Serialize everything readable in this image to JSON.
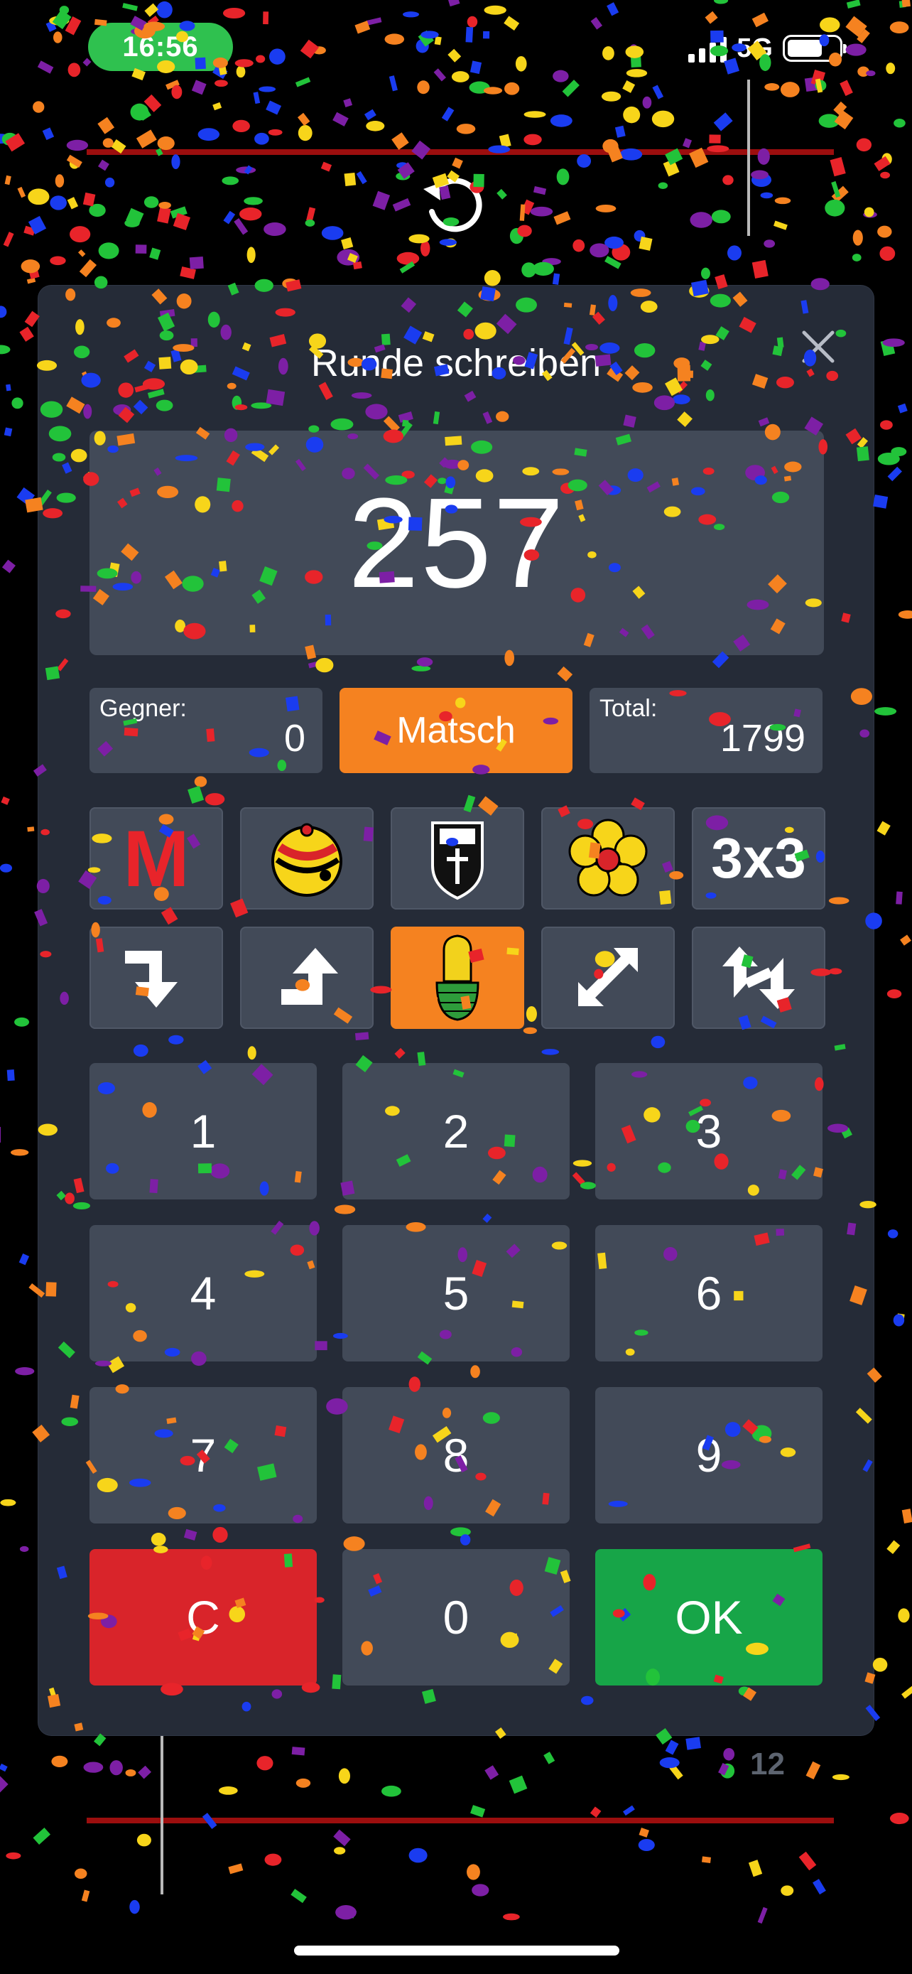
{
  "status_bar": {
    "time": "16:56",
    "network": "5G"
  },
  "background": {
    "score_number": "12"
  },
  "modal": {
    "title": "Runde schreiben",
    "display_value": "257",
    "opponent": {
      "label": "Gegner:",
      "value": "0"
    },
    "matsch_label": "Matsch",
    "total": {
      "label": "Total:",
      "value": "1799"
    },
    "trump_row": [
      {
        "icon": "misere-m-icon",
        "label": "M"
      },
      {
        "icon": "schellen-bell-icon"
      },
      {
        "icon": "schilten-shield-icon"
      },
      {
        "icon": "rosen-flower-icon"
      },
      {
        "icon": "three-by-three-icon",
        "label": "3x3"
      }
    ],
    "direction_row": [
      {
        "icon": "turn-down-arrow-icon"
      },
      {
        "icon": "turn-up-arrow-icon"
      },
      {
        "icon": "eicheln-acorn-icon",
        "active": true
      },
      {
        "icon": "diagonal-double-arrow-icon"
      },
      {
        "icon": "swap-up-down-arrow-icon"
      }
    ],
    "keypad": [
      "1",
      "2",
      "3",
      "4",
      "5",
      "6",
      "7",
      "8",
      "9",
      "C",
      "0",
      "OK"
    ]
  },
  "colors": {
    "accent": "#f58220",
    "ok": "#17a548",
    "clear": "#d9242a",
    "panel": "#252b37",
    "tile": "#424a58"
  }
}
